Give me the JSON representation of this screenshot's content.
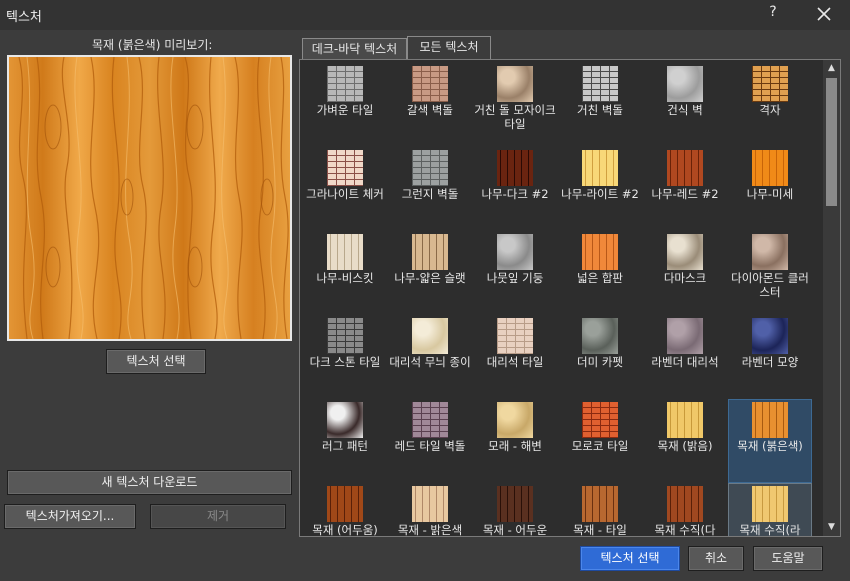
{
  "window": {
    "title": "텍스처",
    "help_label": "?"
  },
  "preview": {
    "label": "목재 (붉은색) 미리보기:"
  },
  "buttons": {
    "select_texture": "텍스처 선택",
    "download_new": "새 텍스처 다운로드",
    "import": "텍스처가져오기...",
    "remove": "제거",
    "ok": "텍스처 선택",
    "cancel": "취소",
    "help": "도움말"
  },
  "tabs": [
    {
      "label": "데크-바닥 텍스처",
      "active": false
    },
    {
      "label": "모든 텍스처",
      "active": true
    }
  ],
  "textures": [
    {
      "label": "가벼운 타일",
      "icon": "light-tile",
      "c1": "#b8b8b8",
      "c2": "#6e6e6e"
    },
    {
      "label": "갈색 벽돌",
      "icon": "brown-brick",
      "c1": "#c89a84",
      "c2": "#8a5e4a"
    },
    {
      "label": "거친 돌 모자이크 타일",
      "icon": "rough-stone-mosaic",
      "c1": "#e2cbb0",
      "c2": "#9a8068"
    },
    {
      "label": "거친 벽돌",
      "icon": "rough-brick",
      "c1": "#c8c8c8",
      "c2": "#4a4a4a"
    },
    {
      "label": "건식 벽",
      "icon": "drywall",
      "c1": "#d0d0d0",
      "c2": "#9c9c9c"
    },
    {
      "label": "격자",
      "icon": "lattice",
      "c1": "#e0a050",
      "c2": "#6a3a10"
    },
    {
      "label": "그라나이트 체커",
      "icon": "granite-checker",
      "c1": "#f0d8c8",
      "c2": "#8a5048"
    },
    {
      "label": "그런지 벽돌",
      "icon": "grunge-brick",
      "c1": "#9ca0a0",
      "c2": "#5c6060"
    },
    {
      "label": "나무-다크 #2",
      "icon": "wood-dark",
      "c1": "#6a2410",
      "c2": "#2a0a04"
    },
    {
      "label": "나무-라이트 #2",
      "icon": "wood-light",
      "c1": "#f8d878",
      "c2": "#d0a040"
    },
    {
      "label": "나무-레드 #2",
      "icon": "wood-red",
      "c1": "#b04820",
      "c2": "#6a2208"
    },
    {
      "label": "나무-미세",
      "icon": "wood-fine",
      "c1": "#f08a18",
      "c2": "#c86408"
    },
    {
      "label": "나무-비스킷",
      "icon": "wood-biscuit",
      "c1": "#e8dcc8",
      "c2": "#b8a88c"
    },
    {
      "label": "나무-얇은 슬랫",
      "icon": "wood-thin-slat",
      "c1": "#d8b890",
      "c2": "#8a6a48"
    },
    {
      "label": "나뭇잎 기둥",
      "icon": "leaf-pillar",
      "c1": "#c8c8c8",
      "c2": "#8a8a8a"
    },
    {
      "label": "넓은 합판",
      "icon": "wide-plywood",
      "c1": "#f0883a",
      "c2": "#b85818"
    },
    {
      "label": "다마스크",
      "icon": "damask",
      "c1": "#e8e0d0",
      "c2": "#9a8c78"
    },
    {
      "label": "다이아몬드 클러스터",
      "icon": "diamond-cluster",
      "c1": "#d0b8a8",
      "c2": "#8a7060"
    },
    {
      "label": "다크 스톤 타일",
      "icon": "dark-stone-tile",
      "c1": "#8a8a8a",
      "c2": "#3a3a3a"
    },
    {
      "label": "대리석 무늬 종이",
      "icon": "marble-paper",
      "c1": "#f4ecd8",
      "c2": "#d8c8a0"
    },
    {
      "label": "대리석 타일",
      "icon": "marble-tile",
      "c1": "#e8d0c0",
      "c2": "#b89c88"
    },
    {
      "label": "더미 카펫",
      "icon": "dummy-carpet",
      "c1": "#9aa09a",
      "c2": "#5a605a"
    },
    {
      "label": "라벤더 대리석",
      "icon": "lavender-marble",
      "c1": "#b0a0a8",
      "c2": "#7a6a74"
    },
    {
      "label": "라벤더 모양",
      "icon": "lavender-pattern",
      "c1": "#5060a8",
      "c2": "#1c2458"
    },
    {
      "label": "러그 패턴",
      "icon": "rug-pattern",
      "c1": "#f0f0f0",
      "c2": "#3a2a2a"
    },
    {
      "label": "레드 타일 벽돌",
      "icon": "red-tile-brick",
      "c1": "#a08898",
      "c2": "#5a4050"
    },
    {
      "label": "모래 - 해변",
      "icon": "sand-beach",
      "c1": "#f0d8a0",
      "c2": "#c8a868"
    },
    {
      "label": "모로코 타일",
      "icon": "moroccan-tile",
      "c1": "#e06030",
      "c2": "#8a2a10"
    },
    {
      "label": "목재 (밝음)",
      "icon": "wood-bright",
      "c1": "#f0c868",
      "c2": "#c89a3a"
    },
    {
      "label": "목재 (붉은색)",
      "icon": "wood-reddish",
      "c1": "#e89030",
      "c2": "#a85a10"
    },
    {
      "label": "목재 (어두움)",
      "icon": "wood-dark-2",
      "c1": "#a04818",
      "c2": "#5a2008"
    },
    {
      "label": "목재 - 밝은색",
      "icon": "wood-light-color",
      "c1": "#e8c8a0",
      "c2": "#b08868"
    },
    {
      "label": "목재 - 어두운",
      "icon": "wood-darker",
      "c1": "#5a3020",
      "c2": "#2a1008"
    },
    {
      "label": "목재 - 타일",
      "icon": "wood-tile",
      "c1": "#b86830",
      "c2": "#6a3010"
    },
    {
      "label": "목재 수직(다",
      "icon": "wood-vertical-dark",
      "c1": "#a04820",
      "c2": "#5a2008"
    },
    {
      "label": "목재 수직(라",
      "icon": "wood-vertical-light",
      "c1": "#f0c870",
      "c2": "#c89a40"
    }
  ],
  "selected_texture": "목재 (붉은색)",
  "hover_texture": "목재 수직(라",
  "colors": {
    "accent": "#2f6bd6",
    "selection": "#304b66",
    "background": "#3c3c3c",
    "wood": "#e0902c"
  }
}
